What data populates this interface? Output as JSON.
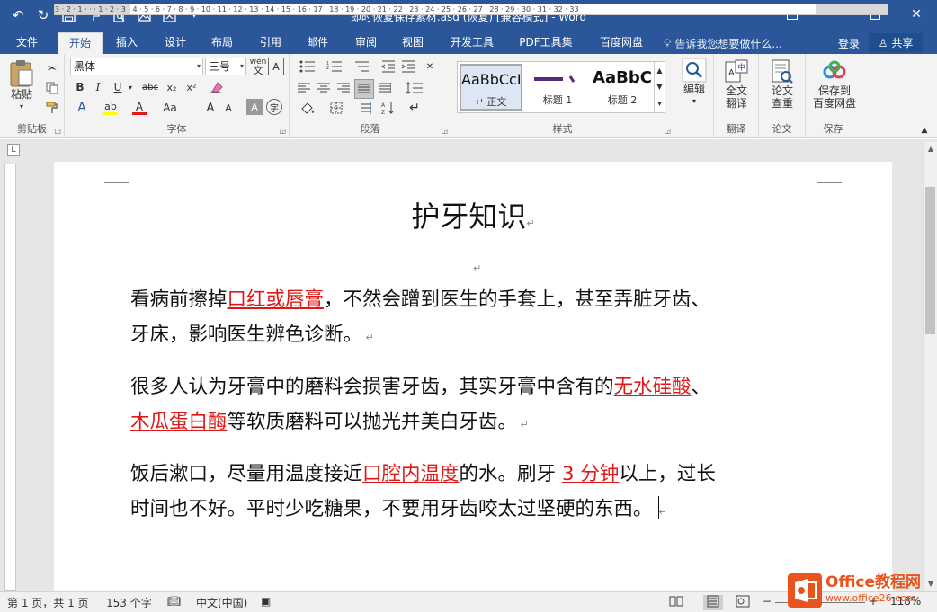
{
  "titlebar": {
    "title": "即时恢复保存素材.asd (恢复) [兼容模式] - Word",
    "bg": "#2b579a"
  },
  "qat": {
    "undo_icon": "undo-icon",
    "redo_icon": "redo-icon",
    "save_icon": "save-icon"
  },
  "tabs": [
    {
      "label": "文件"
    },
    {
      "label": "开始"
    },
    {
      "label": "插入"
    },
    {
      "label": "设计"
    },
    {
      "label": "布局"
    },
    {
      "label": "引用"
    },
    {
      "label": "邮件"
    },
    {
      "label": "审阅"
    },
    {
      "label": "视图"
    },
    {
      "label": "开发工具"
    },
    {
      "label": "PDF工具集"
    },
    {
      "label": "百度网盘"
    }
  ],
  "tell_me": "告诉我您想要做什么...",
  "login": "登录",
  "share": "共享",
  "ribbon": {
    "clipboard": {
      "paste": "粘贴",
      "label": "剪贴板"
    },
    "font": {
      "font_name": "黑体",
      "font_size": "三号",
      "wen": "wén",
      "label": "字体"
    },
    "paragraph": {
      "label": "段落"
    },
    "styles": {
      "items": [
        {
          "preview": "AaBbCcI",
          "name": "↵ 正文"
        },
        {
          "preview": "",
          "name": "标题 1"
        },
        {
          "preview": "AaBbC",
          "name": "标题 2"
        }
      ],
      "label": "样式"
    },
    "editing": {
      "label": "编辑"
    },
    "translate": {
      "btn": "全文\n翻译",
      "label": "翻译"
    },
    "paper": {
      "btn": "论文\n查重",
      "label": "论文"
    },
    "save": {
      "btn": "保存到\n百度网盘",
      "label": "保存"
    }
  },
  "ruler": {
    "numbers": "3 · 2 · 1 · · · 1 · 2 · 3 · 4 · 5 · 6 · 7 · 8 · 9 · 10 · 11 · 12 · 13 · 14 · 15 · 16 · 17 · 18 · 19 · 20 · 21 · 22 · 23 · 24 · 25 · 26 · 27 · 28 · 29 · 30 · 31 · 32 · 33"
  },
  "document": {
    "title": "护牙知识",
    "paragraphs": [
      {
        "line1_a": "看病前擦掉",
        "line1_hl": "口红或唇膏",
        "line1_b": "，不然会蹭到医生的手套上，甚至弄脏牙齿、",
        "line2": "牙床，影响医生辨色诊断。"
      },
      {
        "line1_a": "很多人认为牙膏中的磨料会损害牙齿，其实牙膏中含有的",
        "line1_hl": "无水硅酸",
        "line1_b": "、",
        "line2_hl": "木瓜蛋白酶",
        "line2_b": "等软质磨料可以抛光并美白牙齿。"
      },
      {
        "line1_a": "饭后漱口，尽量用温度接近",
        "line1_hl": "口腔内温度",
        "line1_b": "的水。刷牙 ",
        "line1_hl2": "3 分钟",
        "line1_c": "以上，过长",
        "line2": "时间也不好。平时少吃糖果，不要用牙齿咬太过坚硬的东西。"
      }
    ],
    "highlight_color": "#e01818"
  },
  "status": {
    "page": "第 1 页，共 1 页",
    "words": "153 个字",
    "lang": "中文(中国)",
    "zoom": "118%"
  },
  "watermark": {
    "line1": "Office教程网",
    "line2": "www.office26.com"
  }
}
